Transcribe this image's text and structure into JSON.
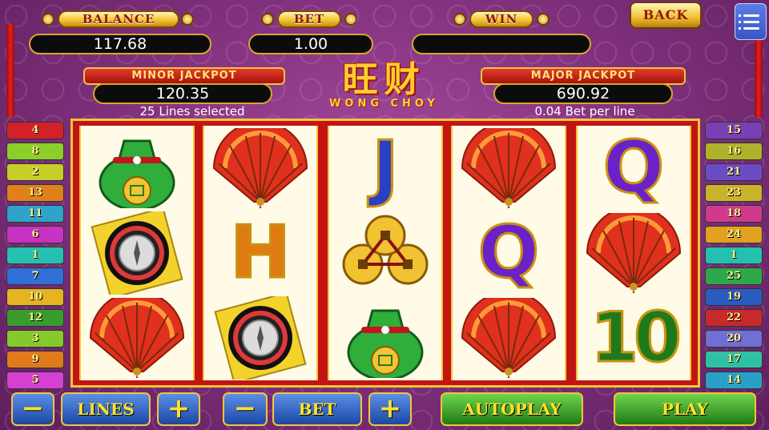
{
  "header": {
    "balance_label": "BALANCE",
    "balance_value": "117.68",
    "bet_label": "BET",
    "bet_value": "1.00",
    "win_label": "WIN",
    "win_value": "",
    "back_label": "BACK",
    "minor_jackpot_label": "MINOR JACKPOT",
    "minor_jackpot_value": "120.35",
    "major_jackpot_label": "MAJOR JACKPOT",
    "major_jackpot_value": "690.92",
    "lines_info": "25 Lines selected",
    "bet_info": "0.04 Bet per line",
    "logo_cn": "旺财",
    "logo_en": "WONG CHOY"
  },
  "left_lines": [
    "4",
    "8",
    "2",
    "13",
    "11",
    "6",
    "1",
    "7",
    "10",
    "12",
    "3",
    "9",
    "5"
  ],
  "right_lines": [
    "15",
    "16",
    "21",
    "23",
    "18",
    "24",
    "1",
    "25",
    "19",
    "22",
    "20",
    "17",
    "14"
  ],
  "reels": [
    [
      "lucky-vase",
      "compass",
      "red-fan"
    ],
    [
      "red-fan",
      "H",
      "compass"
    ],
    [
      "J",
      "coins",
      "lucky-vase"
    ],
    [
      "red-fan",
      "Q",
      "red-fan"
    ],
    [
      "Q",
      "red-fan",
      "10"
    ]
  ],
  "controls": {
    "minus": "−",
    "plus": "+",
    "lines_label": "LINES",
    "bet_label": "BET",
    "autoplay_label": "AUTOPLAY",
    "play_label": "PLAY"
  },
  "colors": {
    "background": "#7d2f7a",
    "gold": "#f4c53a",
    "reel_border": "#c31414",
    "button_blue": "#1b47a5",
    "button_green": "#1f7a16"
  }
}
